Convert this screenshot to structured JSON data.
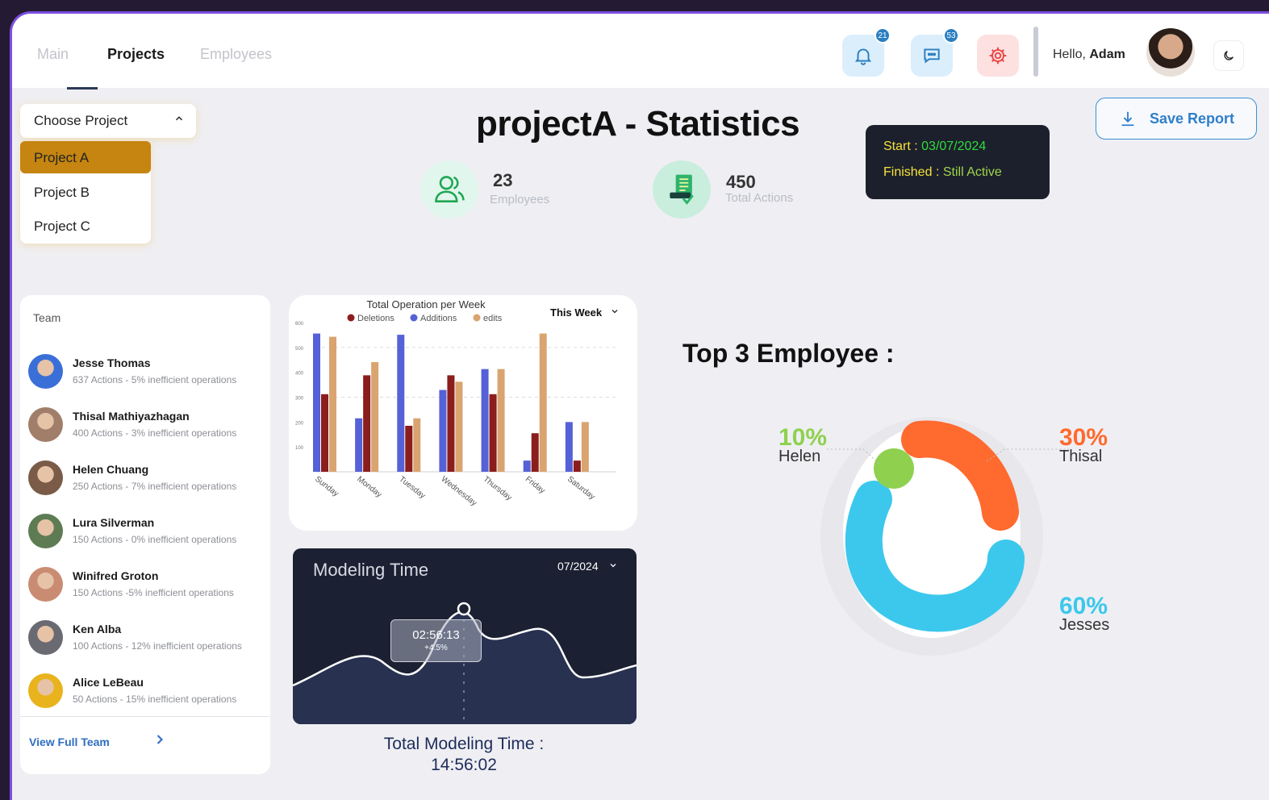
{
  "nav": {
    "tabs": [
      {
        "label": "Main"
      },
      {
        "label": "Projects"
      },
      {
        "label": "Employees"
      }
    ]
  },
  "header": {
    "notifications_count": "21",
    "messages_count": "53",
    "greeting_prefix": "Hello,",
    "user_name": "Adam"
  },
  "project_selector": {
    "label": "Choose Project",
    "options": [
      "Project A",
      "Project B",
      "Project C"
    ],
    "selected": "Project A"
  },
  "page": {
    "title": "projectA - Statistics"
  },
  "stats": {
    "employees": {
      "value": "23",
      "label": "Employees"
    },
    "actions": {
      "value": "450",
      "label": "Total Actions"
    }
  },
  "dates": {
    "start_label": "Start :",
    "start_value": "03/07/2024",
    "finished_label": "Finished",
    "finished_sep": ":",
    "finished_value": "Still Active"
  },
  "save_report_label": "Save Report",
  "team": {
    "title": "Team",
    "members": [
      {
        "name": "Jesse Thomas",
        "info": "637 Actions - 5% inefficient operations"
      },
      {
        "name": "Thisal Mathiyazhagan",
        "info": "400 Actions - 3% inefficient operations"
      },
      {
        "name": "Helen Chuang",
        "info": "250 Actions - 7% inefficient operations"
      },
      {
        "name": "Lura Silverman",
        "info": "150 Actions - 0% inefficient operations"
      },
      {
        "name": "Winifred Groton",
        "info": "150 Actions -5% inefficient operations"
      },
      {
        "name": "Ken Alba",
        "info": "100 Actions - 12% inefficient operations"
      },
      {
        "name": "Alice LeBeau",
        "info": "50 Actions - 15% inefficient operations"
      }
    ],
    "view_full": "View Full Team"
  },
  "chart_data": {
    "type": "bar",
    "title": "Total Operation per Week",
    "filter": "This Week",
    "categories": [
      "Sunday",
      "Monday",
      "Tuesday",
      "Wednesday",
      "Thursday",
      "Friday",
      "Saturday"
    ],
    "ylim": [
      0,
      600
    ],
    "yticks": [
      "100",
      "200",
      "300",
      "400",
      "500",
      "600"
    ],
    "series": [
      {
        "name": "Deletions",
        "color": "#8b1d1d",
        "values": [
          312,
          388,
          185,
          388,
          312,
          155,
          45
        ]
      },
      {
        "name": "Additions",
        "color": "#5561d6",
        "values": [
          556,
          215,
          551,
          329,
          413,
          45,
          200
        ]
      },
      {
        "name": "edits",
        "color": "#d9a470",
        "values": [
          543,
          441,
          215,
          362,
          413,
          556,
          200
        ]
      }
    ]
  },
  "modeling": {
    "title": "Modeling Time",
    "month": "07/2024",
    "tooltip_time": "02:56:13",
    "tooltip_delta": "+4.5%",
    "total_label": "Total Modeling Time :",
    "total_value": "14:56:02"
  },
  "top_employees": {
    "title": "Top 3 Employee :",
    "items": [
      {
        "name": "Helen",
        "pct": "10%",
        "color": "#8fd14f"
      },
      {
        "name": "Thisal",
        "pct": "30%",
        "color": "#ff6a2e"
      },
      {
        "name": "Jesses",
        "pct": "60%",
        "color": "#3cc8ec"
      }
    ]
  }
}
